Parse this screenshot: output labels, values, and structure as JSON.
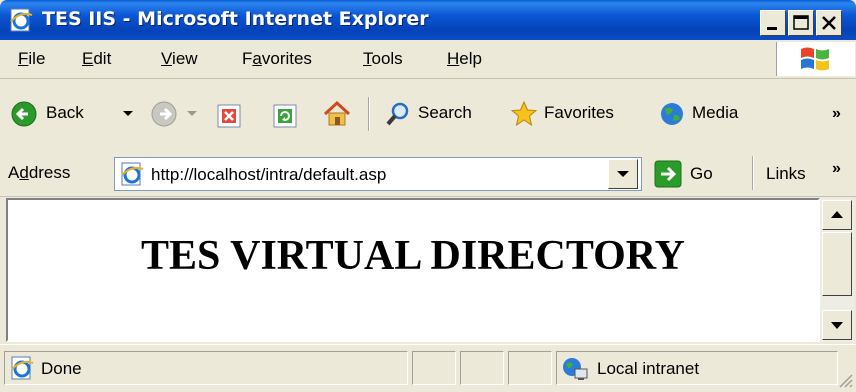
{
  "window": {
    "title": "TES IIS - Microsoft Internet Explorer",
    "controls": [
      "minimize-button",
      "maximize-button",
      "close-button"
    ]
  },
  "menu": {
    "items": [
      {
        "mnemonic": "F",
        "rest": "ile"
      },
      {
        "mnemonic": "E",
        "rest": "dit"
      },
      {
        "mnemonic": "V",
        "rest": "iew"
      },
      {
        "prefix": "F",
        "mnemonic": "a",
        "rest": "vorites"
      },
      {
        "mnemonic": "T",
        "rest": "ools"
      },
      {
        "mnemonic": "H",
        "rest": "elp"
      }
    ]
  },
  "toolbar": {
    "back_label": "Back",
    "search_label": "Search",
    "favorites_label": "Favorites",
    "media_label": "Media",
    "overflow": "»"
  },
  "address": {
    "label_prefix": "A",
    "label_mnemonic": "d",
    "label_rest": "dress",
    "url": "http://localhost/intra/default.asp",
    "go_label": "Go",
    "links_label": "Links",
    "links_overflow": "»"
  },
  "content": {
    "heading": "TES VIRTUAL DIRECTORY"
  },
  "status": {
    "text": "Done",
    "zone": "Local intranet"
  },
  "colors": {
    "titlebar": "#0a55d3",
    "chrome": "#ece9d8",
    "go_green": "#2a9c2a"
  }
}
